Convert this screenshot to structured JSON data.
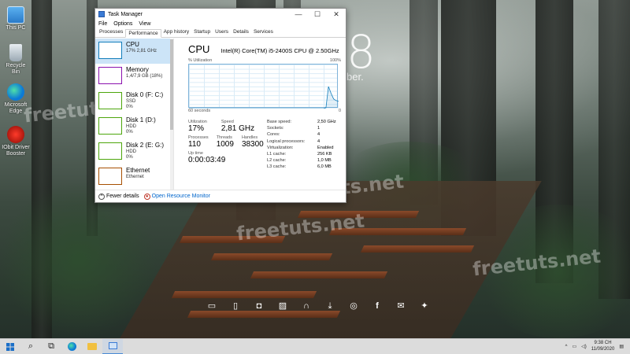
{
  "desktop": {
    "icons": [
      {
        "label": "This PC",
        "icon": "this-pc-icon"
      },
      {
        "label": "Recycle Bin",
        "icon": "recycle-bin-icon"
      },
      {
        "label": "Microsoft Edge",
        "icon": "edge-icon"
      },
      {
        "label": "IObit Driver Booster",
        "icon": "driver-booster-icon"
      }
    ],
    "clock_digit": "8",
    "date_fragment": "ber.",
    "watermarks": [
      "freetuts.net",
      "freetuts.net",
      "freetuts.net",
      "freetuts.net"
    ],
    "dock_icons": [
      "monitor-icon",
      "document-icon",
      "save-icon",
      "image-icon",
      "headphones-icon",
      "download-icon",
      "chrome-icon",
      "facebook-icon",
      "mail-icon",
      "puzzle-icon"
    ]
  },
  "task_manager": {
    "title": "Task Manager",
    "menu": [
      "File",
      "Options",
      "View"
    ],
    "tabs": [
      "Processes",
      "Performance",
      "App history",
      "Startup",
      "Users",
      "Details",
      "Services"
    ],
    "selected_tab": "Performance",
    "resources": [
      {
        "name": "CPU",
        "sub1": "17% 2,81 GHz",
        "sub2": "",
        "color": "#117dbb"
      },
      {
        "name": "Memory",
        "sub1": "1,4/7,9 GB (18%)",
        "sub2": "",
        "color": "#8b12ae"
      },
      {
        "name": "Disk 0 (F: C:)",
        "sub1": "SSD",
        "sub2": "0%",
        "color": "#4da60c"
      },
      {
        "name": "Disk 1 (D:)",
        "sub1": "HDD",
        "sub2": "0%",
        "color": "#4da60c"
      },
      {
        "name": "Disk 2 (E: G:)",
        "sub1": "HDD",
        "sub2": "0%",
        "color": "#4da60c"
      },
      {
        "name": "Ethernet",
        "sub1": "Ethernet",
        "sub2": "",
        "color": "#a74f01"
      }
    ],
    "cpu": {
      "heading": "CPU",
      "model": "Intel(R) Core(TM) i5-2400S CPU @ 2.50GHz",
      "graph_top_left": "% Utilization",
      "graph_top_right": "100%",
      "graph_bottom_left": "60 seconds",
      "graph_bottom_right": "0",
      "utilization_label": "Utilization",
      "utilization": "17%",
      "speed_label": "Speed",
      "speed": "2,81 GHz",
      "processes_label": "Processes",
      "processes": "110",
      "threads_label": "Threads",
      "threads": "1009",
      "handles_label": "Handles",
      "handles": "38300",
      "uptime_label": "Up time",
      "uptime": "0:00:03:49",
      "specs": [
        {
          "label": "Base speed:",
          "value": "2,50 GHz"
        },
        {
          "label": "Sockets:",
          "value": "1"
        },
        {
          "label": "Cores:",
          "value": "4"
        },
        {
          "label": "Logical processors:",
          "value": "4"
        },
        {
          "label": "Virtualization:",
          "value": "Enabled"
        },
        {
          "label": "L1 cache:",
          "value": "256 KB"
        },
        {
          "label": "L2 cache:",
          "value": "1,0 MB"
        },
        {
          "label": "L3 cache:",
          "value": "6,0 MB"
        }
      ],
      "usage_history": [
        0,
        0,
        0,
        0,
        0,
        0,
        0,
        0,
        0,
        0,
        0,
        0,
        0,
        0,
        0,
        0,
        0,
        0,
        0,
        0,
        0,
        0,
        0,
        0,
        0,
        0,
        0,
        0,
        0,
        0,
        0,
        0,
        0,
        0,
        0,
        0,
        0,
        0,
        0,
        0,
        0,
        0,
        0,
        0,
        0,
        0,
        0,
        0,
        0,
        0,
        0,
        0,
        0,
        0,
        2,
        50,
        35,
        22,
        18,
        17
      ]
    },
    "footer": {
      "fewer_details": "Fewer details",
      "open_monitor": "Open Resource Monitor"
    }
  },
  "taskbar": {
    "time": "9:38 CH",
    "date": "11/09/2020"
  }
}
